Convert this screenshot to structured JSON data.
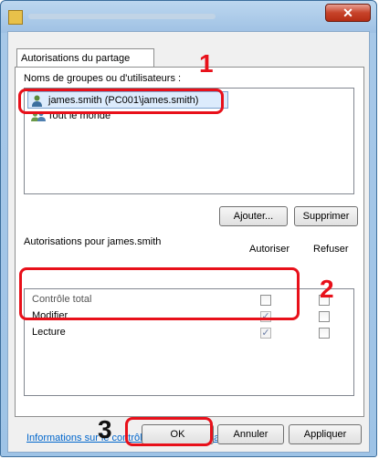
{
  "dialog": {
    "close_glyph": "✕"
  },
  "tab": {
    "label": "Autorisations du partage"
  },
  "users": {
    "heading": "Noms de groupes ou d'utilisateurs :",
    "items": [
      {
        "label": "james.smith (PC001\\james.smith)",
        "icon": "user-icon",
        "selected": true
      },
      {
        "label": "Tout le monde",
        "icon": "group-icon",
        "selected": false
      }
    ],
    "add_button": "Ajouter...",
    "remove_button": "Supprimer"
  },
  "permissions": {
    "heading": "Autorisations pour james.smith",
    "allow_header": "Autoriser",
    "deny_header": "Refuser",
    "rows": [
      {
        "name": "Contrôle total",
        "allow": false,
        "deny": false
      },
      {
        "name": "Modifier",
        "allow": true,
        "deny": false
      },
      {
        "name": "Lecture",
        "allow": true,
        "deny": false
      }
    ]
  },
  "info_link": "Informations sur le contrôle d'accès et les autorisations",
  "buttons": {
    "ok": "OK",
    "cancel": "Annuler",
    "apply": "Appliquer"
  },
  "annotations": {
    "one": "1",
    "two": "2",
    "three": "3"
  },
  "colors": {
    "callout": "#e8101a",
    "link": "#0066cc",
    "selection": "#dcebfc"
  }
}
